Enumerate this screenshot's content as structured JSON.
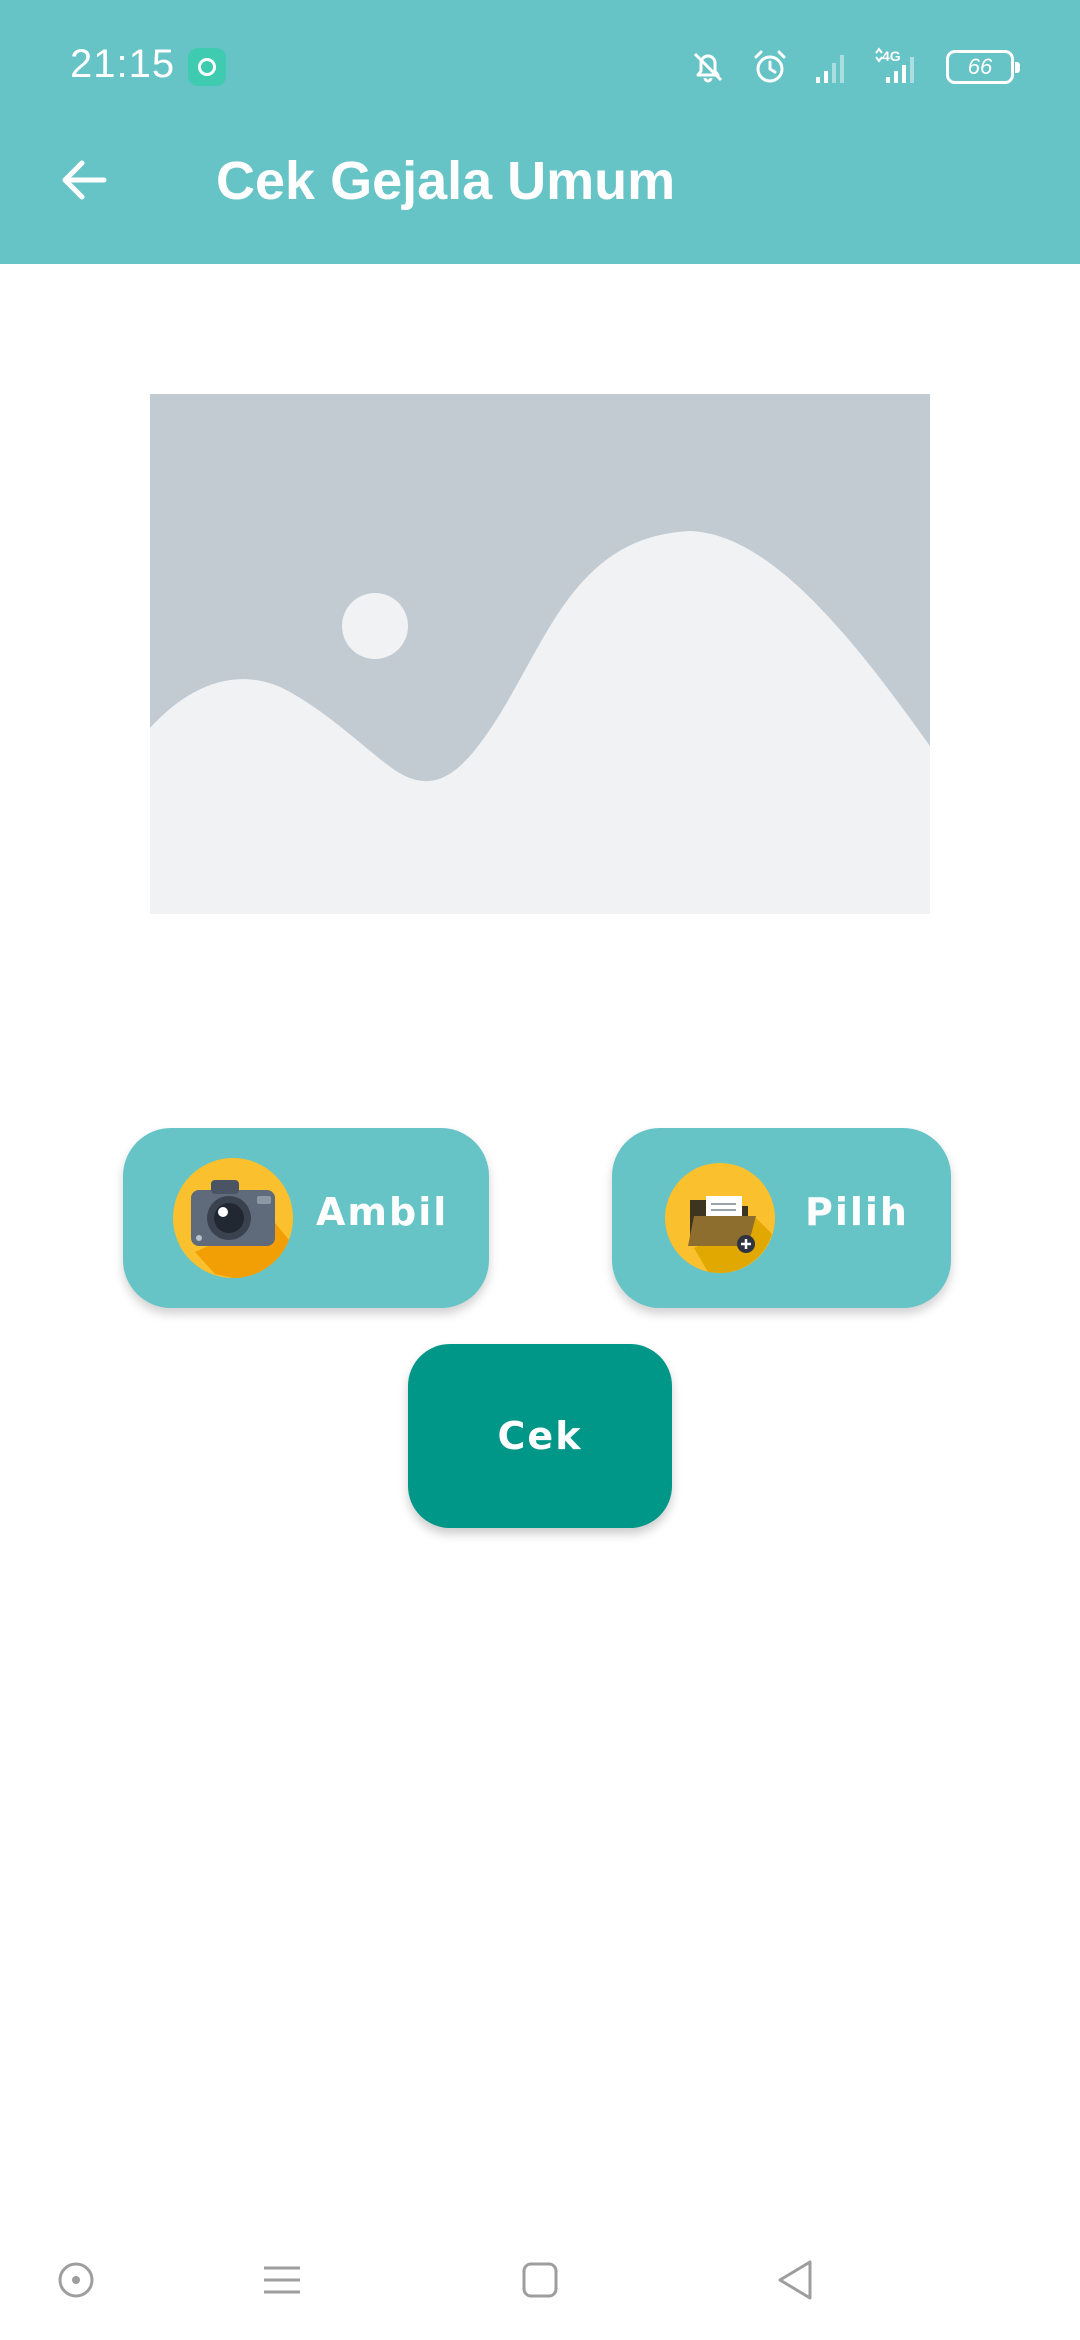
{
  "status_bar": {
    "time": "21:15",
    "network_label": "4G",
    "battery": "66"
  },
  "header": {
    "title": "Cek Gejala Umum",
    "back_icon": "arrow-left-icon"
  },
  "image_preview": {
    "icon": "image-placeholder-icon"
  },
  "actions": {
    "ambil_label": "Ambil",
    "ambil_icon": "camera-icon",
    "pilih_label": "Pilih",
    "pilih_icon": "folder-icon",
    "cek_label": "Cek"
  },
  "nav": {
    "icons": [
      "circle-dot-icon",
      "menu-lines-icon",
      "square-home-icon",
      "triangle-back-icon"
    ]
  },
  "colors": {
    "header": "#66C3C6",
    "action_button": "#66C3C6",
    "primary_button": "#009688",
    "placeholder_bg": "#C3CBD2",
    "placeholder_fg": "#F0F2F4"
  }
}
